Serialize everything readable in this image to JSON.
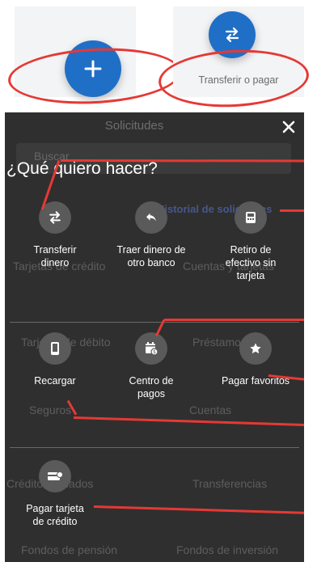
{
  "transfer_caption": "Transferir o pagar",
  "background_screen": {
    "title": "Solicitudes",
    "search_placeholder": "Buscar",
    "history_link": "Historial de solicitudes",
    "items": [
      "Tarjetas de crédito",
      "Cuentas y tarjetas",
      "Tarjetas de débito",
      "Préstamos",
      "Seguros",
      "Cuentas",
      "Créditos afiliados",
      "Transferencias",
      "Fondos de pensión",
      "Fondos de inversión"
    ]
  },
  "modal": {
    "title": "¿Qué quiero hacer?",
    "actions": [
      {
        "label": "Transferir\ndinero",
        "icon": "transfer-icon"
      },
      {
        "label": "Traer dinero de\notro banco",
        "icon": "reply-arrow-icon"
      },
      {
        "label": "Retiro de\nefectivo sin\ntarjeta",
        "icon": "atm-icon"
      },
      {
        "label": "Recargar",
        "icon": "phone-icon"
      },
      {
        "label": "Centro de\npagos",
        "icon": "calendar-payment-icon"
      },
      {
        "label": "Pagar favoritos",
        "icon": "star-icon"
      },
      {
        "label": "Pagar tarjeta\nde crédito",
        "icon": "credit-card-icon"
      }
    ]
  },
  "colors": {
    "accent": "#1f6fc7",
    "annotation": "#e53935",
    "overlay": "#2f2f2f"
  }
}
